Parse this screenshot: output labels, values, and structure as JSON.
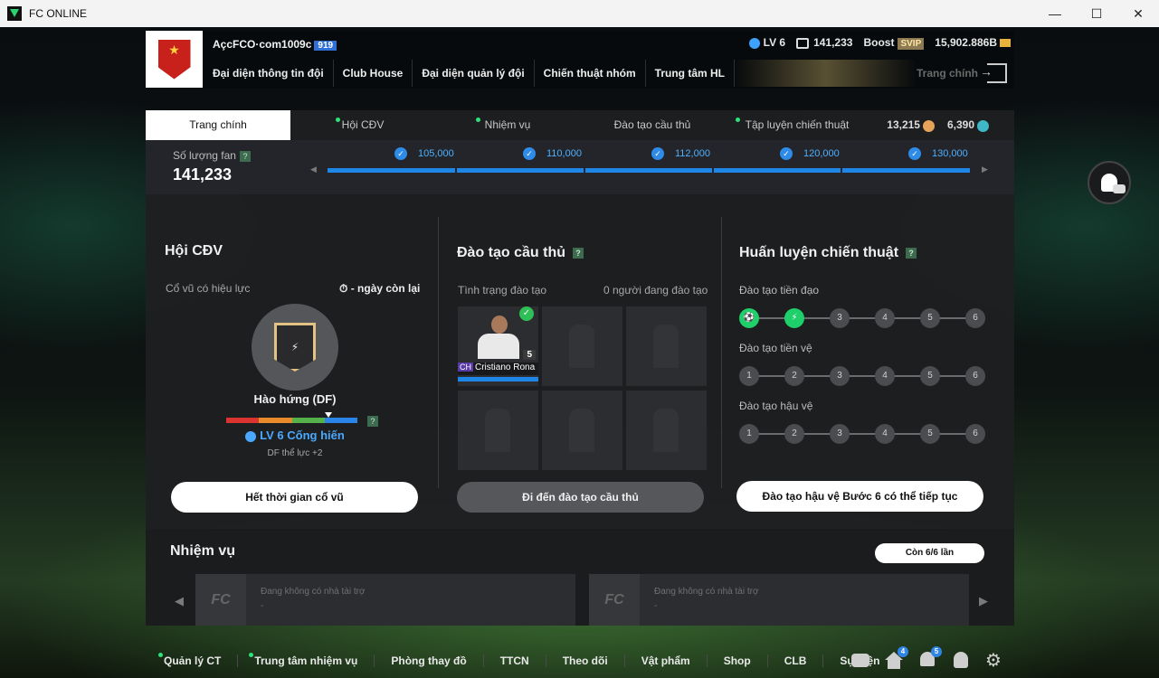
{
  "window": {
    "title": "FC ONLINE",
    "minimize": "—",
    "maximize": "☐",
    "close": "✕"
  },
  "header": {
    "account_name": "AçcFCO·com1009c",
    "account_tag": "919",
    "level": "LV 6",
    "fans": "141,233",
    "boost_label": "Boost",
    "svip": "SVIP",
    "bp": "15,902.886B",
    "nav": [
      "Đại diện thông tin đội",
      "Club House",
      "Đại diện quản lý đội",
      "Chiến thuật nhóm",
      "Trung tâm HL"
    ],
    "home_ghost": "Trang chính"
  },
  "tabs": {
    "items": [
      "Trang chính",
      "Hội CĐV",
      "Nhiệm vụ",
      "Đào tạo cầu thủ",
      "Tập luyện chiến thuật"
    ],
    "currency_a": "13,215",
    "currency_b": "6,390"
  },
  "fan_progress": {
    "label": "Số lượng fan",
    "help": "?",
    "value": "141,233",
    "milestones": [
      "105,000",
      "110,000",
      "112,000",
      "120,000",
      "130,000"
    ],
    "progress_fraction": 1.0
  },
  "supporters": {
    "title": "Hội CĐV",
    "cheer_label": "Cổ vũ có hiệu lực",
    "days_left": "- ngày còn lại",
    "cheer_name": "Hào hứng (DF)",
    "help": "?",
    "level_text": "LV 6 Cống hiến",
    "bonus_text": "DF thể lực +2",
    "button": "Hết thời gian cổ vũ",
    "meter_level": 0.78,
    "meter_colors": [
      "#d9342f",
      "#e8892a",
      "#55b24a",
      "#2b84e8"
    ]
  },
  "training": {
    "title": "Đào tạo cầu thủ",
    "help": "?",
    "status_label": "Tình trạng đào tạo",
    "count_label": "0 người đang đào tạo",
    "player_name": "Cristiano Rona",
    "player_season": "CH",
    "player_ovr": "5",
    "button": "Đi đến đào tạo cầu thủ"
  },
  "tactics": {
    "title": "Huấn luyện chiến thuật",
    "help": "?",
    "rows": [
      {
        "label": "Đào tạo tiền đạo",
        "steps": [
          "1",
          "2",
          "3",
          "4",
          "5",
          "6"
        ],
        "done": 2
      },
      {
        "label": "Đào tạo tiền vệ",
        "steps": [
          "1",
          "2",
          "3",
          "4",
          "5",
          "6"
        ],
        "done": 0
      },
      {
        "label": "Đào tạo hậu vệ",
        "steps": [
          "1",
          "2",
          "3",
          "4",
          "5",
          "6"
        ],
        "done": 0
      }
    ],
    "button": "Đào tạo hậu vệ Bước 6 có thể tiếp tục"
  },
  "missions": {
    "title": "Nhiệm vụ",
    "remaining": "Còn 6/6 lần",
    "cards": [
      {
        "text": "Đang không có nhà tài trợ",
        "sub": "-"
      },
      {
        "text": "Đang không có nhà tài trợ",
        "sub": "-"
      }
    ]
  },
  "bottom_nav": {
    "items": [
      "Quản lý CT",
      "Trung tâm nhiệm vụ",
      "Phòng thay đồ",
      "TTCN",
      "Theo dõi",
      "Vật phẩm",
      "Shop",
      "CLB",
      "Sự kiện"
    ],
    "home_badge": "4",
    "bell_badge": "5"
  }
}
